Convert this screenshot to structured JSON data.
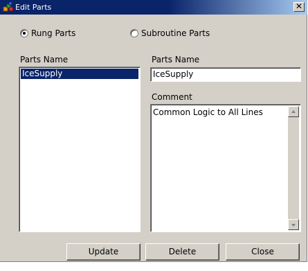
{
  "window": {
    "title": "Edit Parts",
    "close_symbol": "✕",
    "icon": "parts-app-icon"
  },
  "mode": {
    "options": [
      {
        "label": "Rung Parts",
        "selected": true
      },
      {
        "label": "Subroutine Parts",
        "selected": false
      }
    ]
  },
  "parts_list": {
    "label": "Parts Name",
    "items": [
      {
        "name": "IceSupply",
        "selected": true
      }
    ]
  },
  "details": {
    "name_label": "Parts Name",
    "name_value": "IceSupply",
    "comment_label": "Comment",
    "comment_value": "Common Logic to All Lines"
  },
  "buttons": {
    "update": "Update",
    "delete": "Delete",
    "close": "Close"
  },
  "colors": {
    "face": "#d4d0c8",
    "title_start": "#0a246a",
    "title_end": "#a6caf0",
    "selection": "#0a246a"
  }
}
